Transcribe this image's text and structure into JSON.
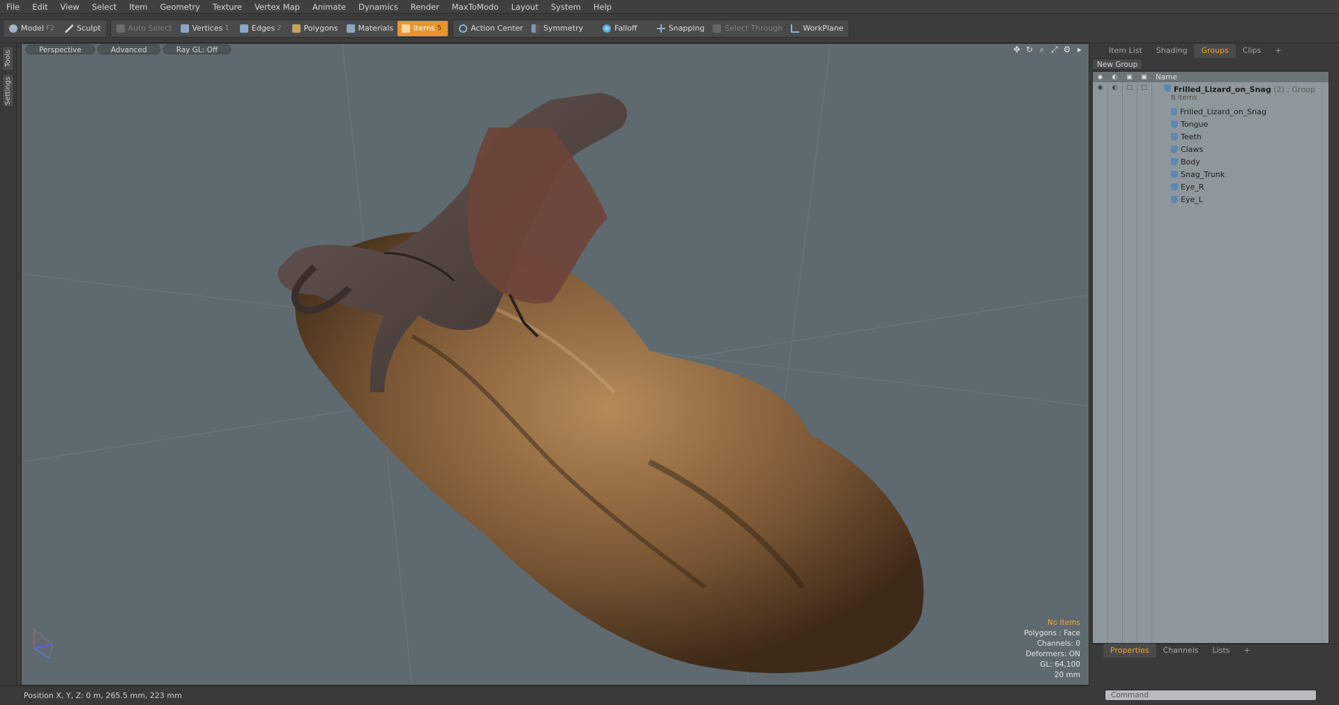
{
  "menu": [
    "File",
    "Edit",
    "View",
    "Select",
    "Item",
    "Geometry",
    "Texture",
    "Vertex Map",
    "Animate",
    "Dynamics",
    "Render",
    "MaxToModo",
    "Layout",
    "System",
    "Help"
  ],
  "toolbar": {
    "model": "Model",
    "model_key": "F2",
    "sculpt": "Sculpt",
    "auto_select": "Auto Select",
    "vertices": "Vertices",
    "vertices_key": "1",
    "edges": "Edges",
    "edges_key": "2",
    "polygons": "Polygons",
    "materials": "Materials",
    "items": "Items",
    "items_key": "5",
    "action_center": "Action Center",
    "symmetry": "Symmetry",
    "falloff": "Falloff",
    "snapping": "Snapping",
    "select_through": "Select Through",
    "workplane": "WorkPlane"
  },
  "left_tabs": [
    "Tools",
    "Settings"
  ],
  "viewport": {
    "view": "Perspective",
    "shading": "Advanced",
    "raygl": "Ray GL: Off",
    "stats": {
      "selection": "No Items",
      "polygons": "Polygons : Face",
      "channels": "Channels: 0",
      "deformers": "Deformers: ON",
      "gl": "GL: 64,100",
      "scale": "20 mm"
    }
  },
  "status": {
    "position": "Position X, Y, Z:  0 m, 265.5 mm, 223 mm"
  },
  "right_panel": {
    "tabs": [
      "Item List",
      "Shading",
      "Groups",
      "Clips",
      "+"
    ],
    "active_tab": "Groups",
    "new_group": "New Group",
    "name_header": "Name",
    "group": {
      "name": "Frilled_Lizard_on_Snag",
      "suffix": "(2) : Group",
      "count": "8 Items"
    },
    "items": [
      "Frilled_Lizard_on_Snag",
      "Tongue",
      "Teeth",
      "Claws",
      "Body",
      "Snag_Trunk",
      "Eye_R",
      "Eye_L"
    ],
    "bottom_tabs": [
      "Properties",
      "Channels",
      "Lists",
      "+"
    ],
    "command_placeholder": "Command"
  },
  "colors": {
    "accent": "#e8962c",
    "viewport_bg": "#5f6a70"
  }
}
